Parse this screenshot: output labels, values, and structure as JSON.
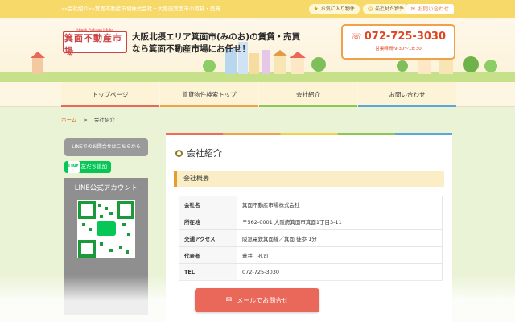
{
  "topbar": {
    "breadcrumb": "»»会社紹介»»箕面不動産市場株式会社－大阪府箕面市の賃貸・売買",
    "favorites": "お気に入り物件",
    "recent": "最近見た物件",
    "sitemap": "サイトマップ",
    "contact": "お問い合わせ"
  },
  "header": {
    "logo_small": "Minoh Fudosan Ichiba",
    "logo_big": "箕面不動産市場",
    "tagline_line1": "大阪北摂エリア箕面市(みのお)の賃貸・売買",
    "tagline_line2": "なら箕面不動産市場にお任せ！",
    "phone": "072-725-3030",
    "hours": "営業時間/9:30～18:30"
  },
  "nav": {
    "items": [
      {
        "label": "トップページ",
        "color": "#e9685a"
      },
      {
        "label": "賃貸物件検索トップ",
        "color": "#f0a24a"
      },
      {
        "label": "会社紹介",
        "color": "#8cc65a"
      },
      {
        "label": "お問い合わせ",
        "color": "#5aa7d8"
      }
    ]
  },
  "crumbs": {
    "home": "ホーム",
    "sep": ">",
    "current": "会社紹介"
  },
  "sidebar": {
    "line_inquiry": "LINEでのお問合せはこちらから",
    "line_add": "友だち追加",
    "line_official": "LINE公式アカウント"
  },
  "main": {
    "page_title": "会社紹介",
    "section_title": "会社概要",
    "rows": [
      {
        "k": "会社名",
        "v": "箕面不動産市場株式会社"
      },
      {
        "k": "所在地",
        "v": "〒562-0001 大阪府箕面市箕面1丁目3-11"
      },
      {
        "k": "交通アクセス",
        "v": "阪急電鉄箕面線／箕面 徒歩 1分"
      },
      {
        "k": "代表者",
        "v": "蓑井　孔司"
      },
      {
        "k": "TEL",
        "v": "072-725-3030"
      }
    ]
  },
  "mail_button": "メールでお問合せ"
}
